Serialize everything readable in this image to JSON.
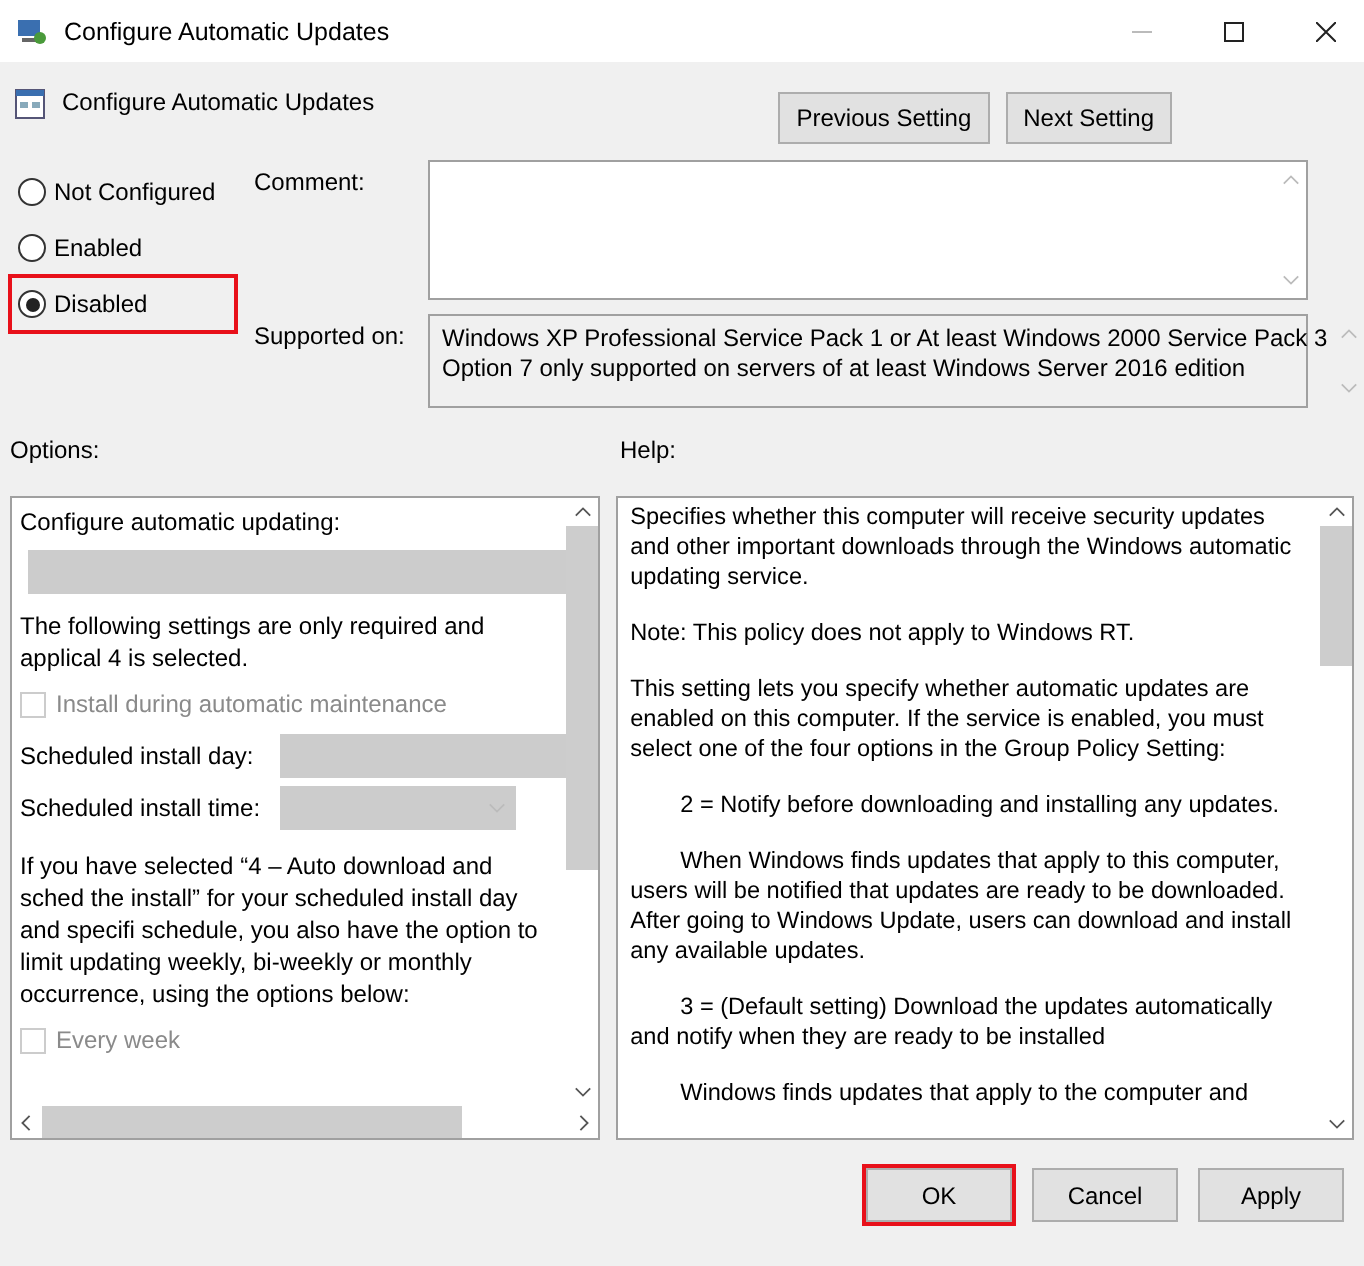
{
  "window": {
    "title": "Configure Automatic Updates"
  },
  "policy_title": "Configure Automatic Updates",
  "nav_buttons": [
    "Previous Setting",
    "Next Setting"
  ],
  "states": [
    {
      "label": "Not Configured",
      "selected": false,
      "highlighted": false
    },
    {
      "label": "Enabled",
      "selected": false,
      "highlighted": false
    },
    {
      "label": "Disabled",
      "selected": true,
      "highlighted": true
    }
  ],
  "comment": {
    "label": "Comment:"
  },
  "supported_on": {
    "label": "Supported on:",
    "lines": [
      "Windows XP Professional Service Pack 1 or At least Windows 2000 Service Pack 3",
      "Option 7 only supported on servers of at least Windows Server 2016 edition"
    ]
  },
  "options": {
    "label": "Options:",
    "items": [
      {
        "kind": "label",
        "text": "Configure automatic updating:"
      },
      {
        "kind": "dropdown",
        "disabled": true
      },
      {
        "kind": "lines",
        "lines": [
          "The following settings are only required and applical 4 is selected."
        ]
      },
      {
        "kind": "checkbox",
        "text": "Install during automatic maintenance",
        "checked": false,
        "disabled": true
      },
      {
        "kind": "field",
        "text": "Scheduled install day:",
        "disabled": true
      },
      {
        "kind": "combo",
        "text": "Scheduled install time:",
        "disabled": true
      },
      {
        "kind": "lines",
        "lines": [
          "If you have selected “4 – Auto download and sched the install” for your scheduled install day and specifi schedule, you also have the option to limit updating weekly, bi-weekly or monthly occurrence, using the options below:"
        ]
      },
      {
        "kind": "checkbox",
        "text": "Every week",
        "checked": false,
        "disabled": true
      }
    ]
  },
  "help": {
    "label": "Help:",
    "paragraphs": [
      {
        "indent": false,
        "text": "Specifies whether this computer will receive security updates and other important downloads through the Windows automatic updating service."
      },
      {
        "indent": false,
        "text": "Note: This policy does not apply to Windows RT."
      },
      {
        "indent": false,
        "text": "This setting lets you specify whether automatic updates are enabled on this computer. If the service is enabled, you must select one of the four options in the Group Policy Setting:"
      },
      {
        "indent": true,
        "text": "2 = Notify before downloading and installing any updates."
      },
      {
        "indent": true,
        "text": "When Windows finds updates that apply to this computer, users will be notified that updates are ready to be downloaded. After going to Windows Update, users can download and install any available updates."
      },
      {
        "indent": true,
        "text": "3 = (Default setting) Download the updates automatically and notify when they are ready to be installed"
      },
      {
        "indent": true,
        "text": "Windows finds updates that apply to the computer and"
      }
    ]
  },
  "buttons": [
    {
      "label": "OK",
      "highlighted": true
    },
    {
      "label": "Cancel",
      "highlighted": false
    },
    {
      "label": "Apply",
      "highlighted": false
    }
  ]
}
